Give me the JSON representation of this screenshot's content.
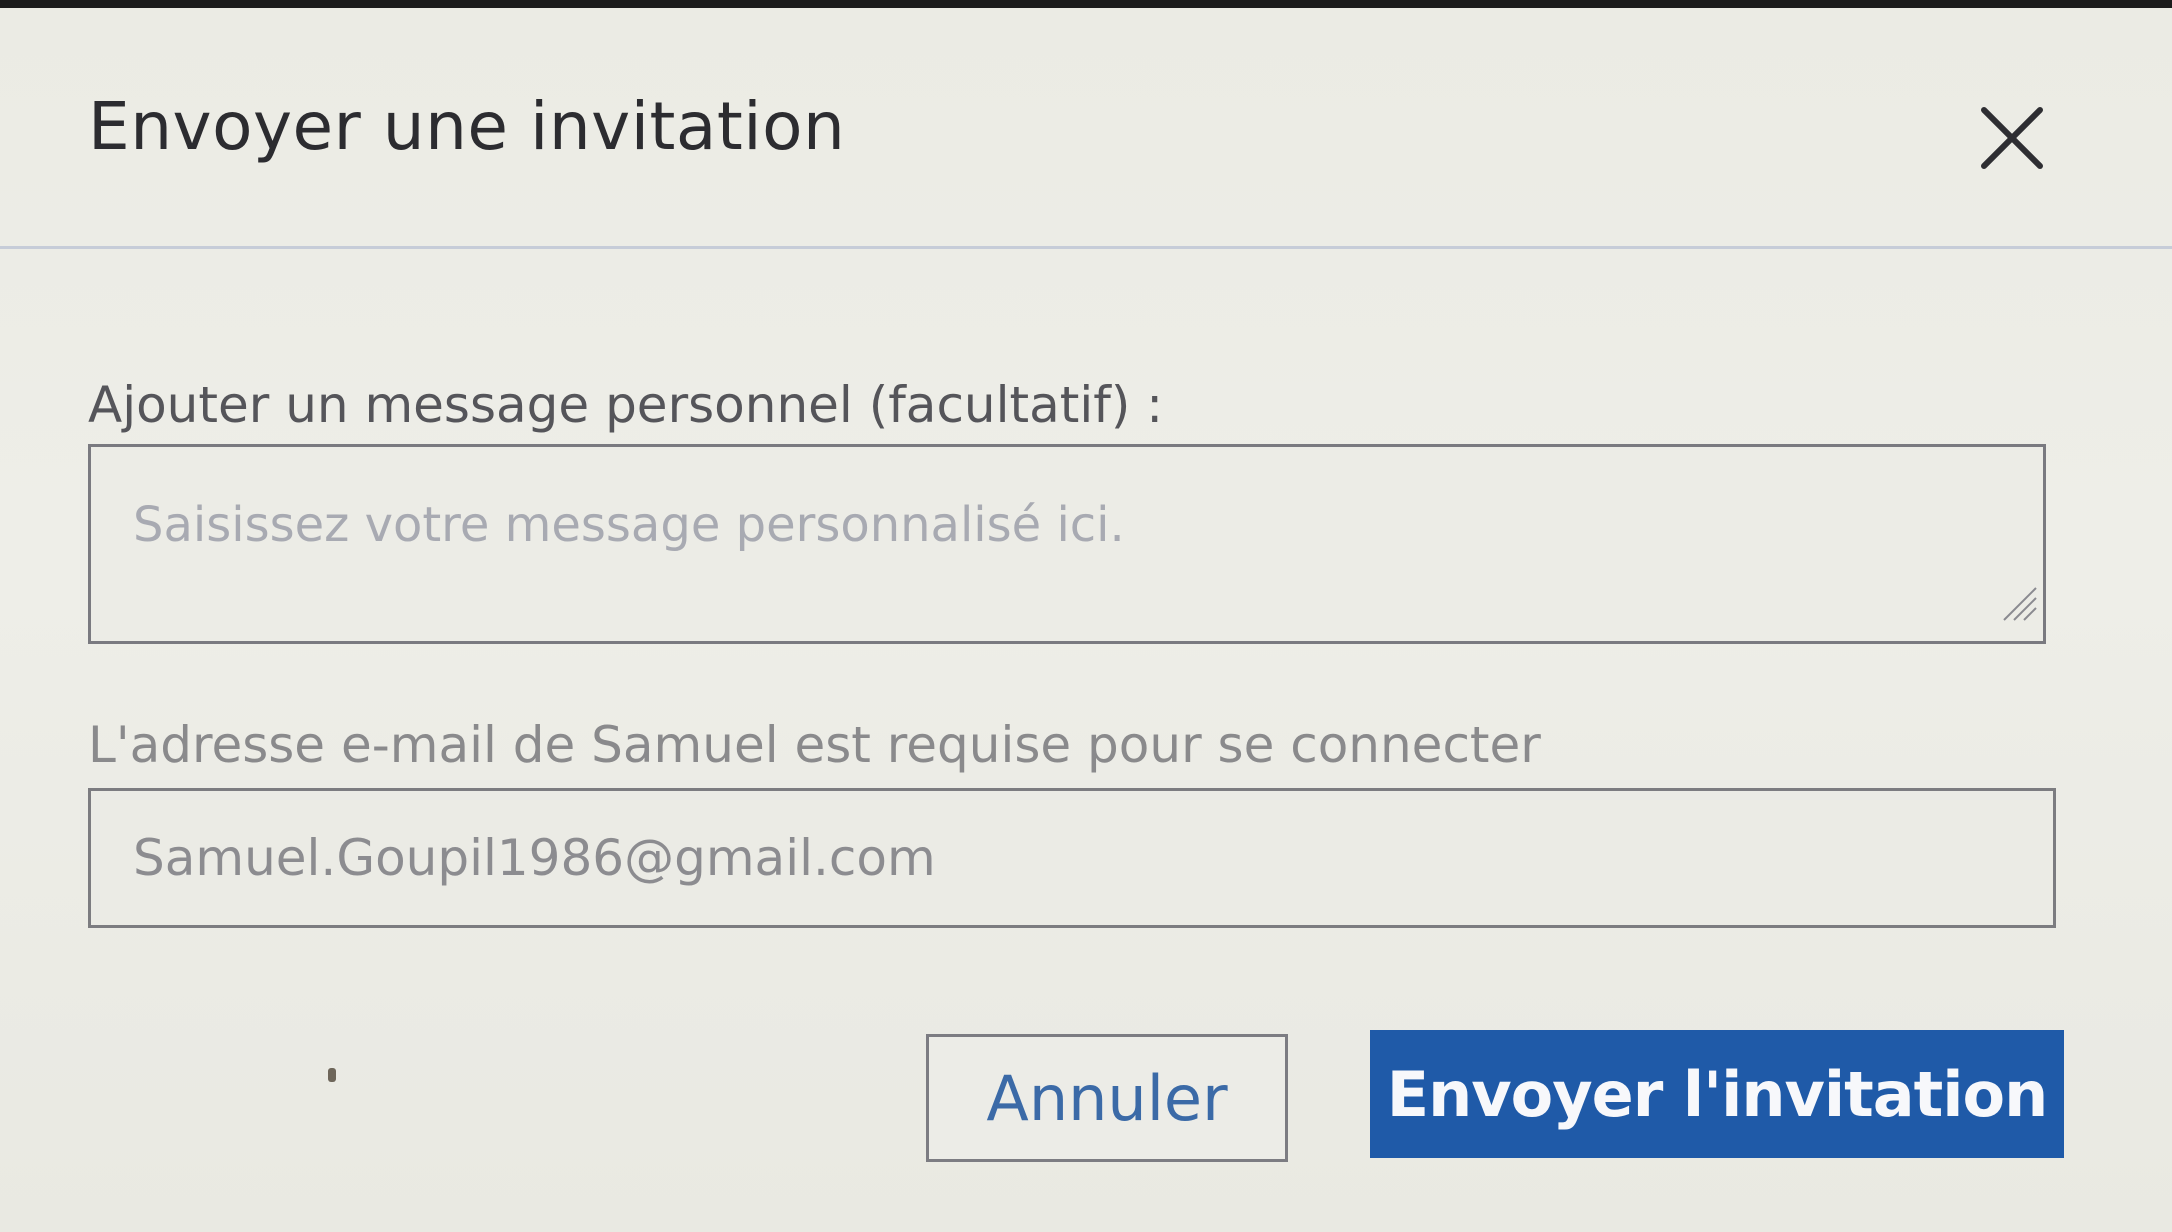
{
  "dialog": {
    "title": "Envoyer une invitation",
    "close_icon": "close-icon"
  },
  "message": {
    "label": "Ajouter un message personnel (facultatif) :",
    "placeholder": "Saisissez votre message personnalisé ici.",
    "value": ""
  },
  "email": {
    "label": "L'adresse e-mail de Samuel est requise pour se connecter",
    "value": "Samuel.Goupil1986@gmail.com"
  },
  "buttons": {
    "cancel_label": "Annuler",
    "send_label": "Envoyer l'invitation"
  },
  "colors": {
    "primary": "#1f5aa8",
    "link": "#3b6aa7",
    "background": "#ebebe4"
  }
}
